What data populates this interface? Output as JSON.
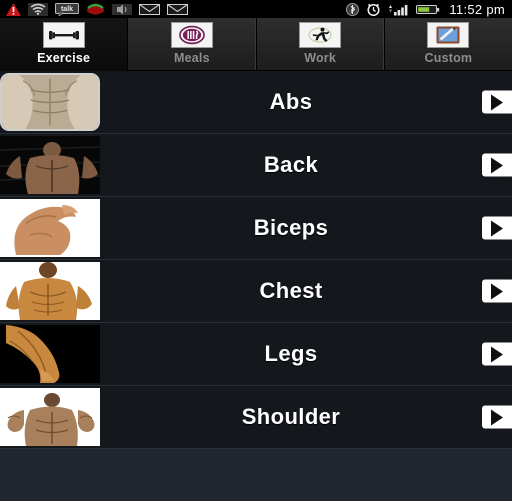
{
  "statusbar": {
    "time": "11:52 pm",
    "left_icons": [
      {
        "name": "warning-icon",
        "label": "warning"
      },
      {
        "name": "wifi-icon",
        "label": "wifi"
      },
      {
        "name": "talk-icon",
        "label": "talk"
      },
      {
        "name": "missed-call-icon",
        "label": "missed call"
      },
      {
        "name": "volume-icon",
        "label": "volume"
      },
      {
        "name": "mail-icon",
        "label": "mail"
      },
      {
        "name": "mail-icon-2",
        "label": "mail"
      }
    ],
    "right_icons": [
      {
        "name": "bluetooth-icon",
        "label": "bluetooth"
      },
      {
        "name": "alarm-icon",
        "label": "alarm"
      },
      {
        "name": "signal-icon",
        "label": "signal"
      },
      {
        "name": "battery-icon",
        "label": "battery"
      }
    ],
    "battery_color": "#8cc63f"
  },
  "tabs": [
    {
      "label": "Exercise",
      "icon": "dumbbell-icon",
      "active": true
    },
    {
      "label": "Meals",
      "icon": "meals-icon",
      "active": false
    },
    {
      "label": "Work",
      "icon": "running-icon",
      "active": false
    },
    {
      "label": "Custom",
      "icon": "notepad-pencil-icon",
      "active": false
    }
  ],
  "list": {
    "items": [
      {
        "label": "Abs",
        "thumb": "abs-thumbnail",
        "framed": true,
        "thumb_bg": "#cbbda9"
      },
      {
        "label": "Back",
        "thumb": "back-thumbnail",
        "framed": false,
        "thumb_bg": "#0a0a0a"
      },
      {
        "label": "Biceps",
        "thumb": "biceps-thumbnail",
        "framed": false,
        "thumb_bg": "#ffffff"
      },
      {
        "label": "Chest",
        "thumb": "chest-thumbnail",
        "framed": false,
        "thumb_bg": "#ffffff"
      },
      {
        "label": "Legs",
        "thumb": "legs-thumbnail",
        "framed": false,
        "thumb_bg": "#000000"
      },
      {
        "label": "Shoulder",
        "thumb": "shoulder-thumbnail",
        "framed": false,
        "thumb_bg": "#ffffff"
      }
    ],
    "arrow_icon": "play-arrow-icon"
  },
  "colors": {
    "row_bg": "#14181d",
    "page_bg": "#21272f",
    "divider": "#2a2f36",
    "active_tab_text": "#ffffff",
    "inactive_tab_text": "#8d8d8d"
  }
}
